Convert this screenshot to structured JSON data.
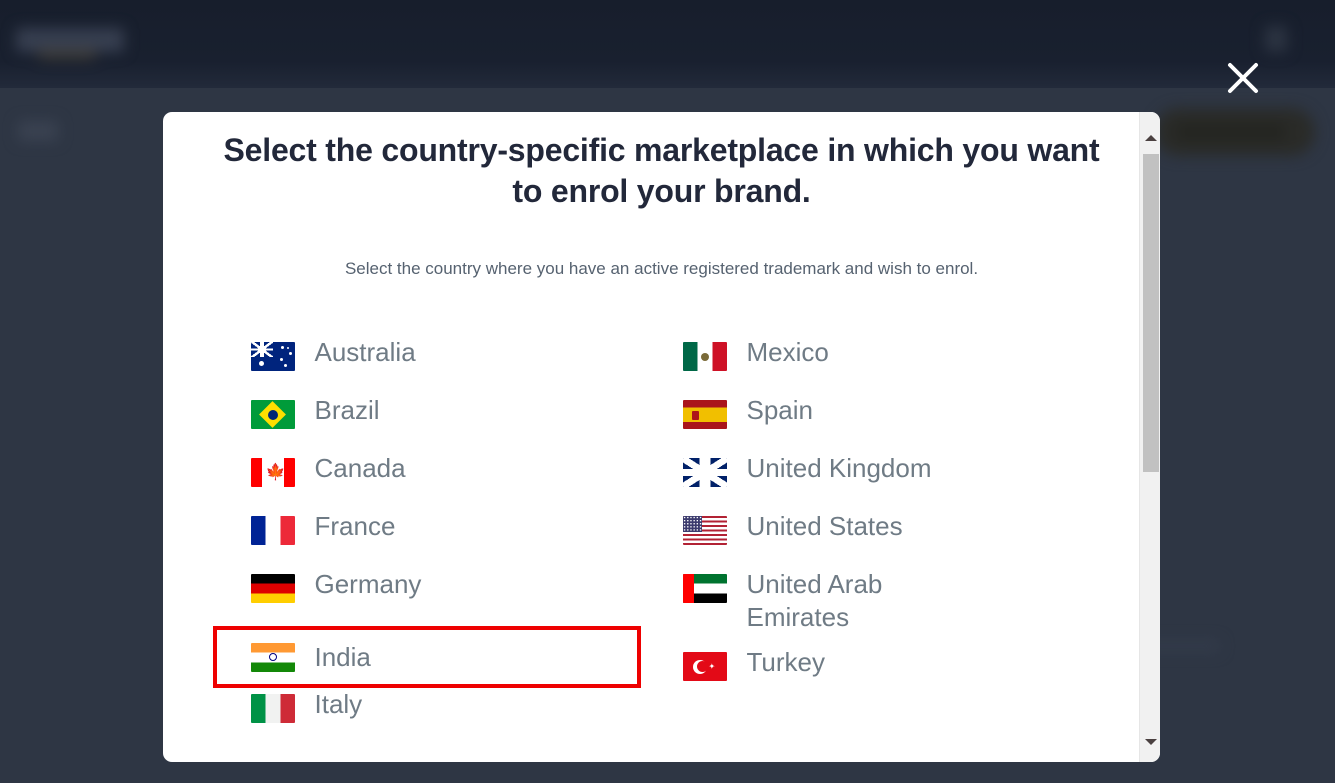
{
  "background": {
    "brand_logo": "amazon-logo",
    "nav_label_blurred": "blurred-nav-label",
    "action_button_blurred": "blurred-action-button"
  },
  "close": {
    "icon": "close-icon",
    "label": "Close"
  },
  "modal": {
    "title": "Select the country-specific marketplace in which you want to enrol your brand.",
    "subtitle": "Select the country where you have an active registered trademark and wish to enrol.",
    "highlight_color": "#ee0000",
    "highlighted_country": "India",
    "columns": {
      "left": [
        {
          "name": "Australia",
          "flag": "flag-australia"
        },
        {
          "name": "Brazil",
          "flag": "flag-brazil"
        },
        {
          "name": "Canada",
          "flag": "flag-canada"
        },
        {
          "name": "France",
          "flag": "flag-france"
        },
        {
          "name": "Germany",
          "flag": "flag-germany"
        },
        {
          "name": "India",
          "flag": "flag-india"
        },
        {
          "name": "Italy",
          "flag": "flag-italy"
        }
      ],
      "right": [
        {
          "name": "Mexico",
          "flag": "flag-mexico"
        },
        {
          "name": "Spain",
          "flag": "flag-spain"
        },
        {
          "name": "United Kingdom",
          "flag": "flag-united-kingdom"
        },
        {
          "name": "United States",
          "flag": "flag-united-states"
        },
        {
          "name": "United Arab\nEmirates",
          "flag": "flag-united-arab-emirates"
        },
        {
          "name": "Turkey",
          "flag": "flag-turkey"
        }
      ]
    }
  },
  "scrollbar": {
    "up_arrow": "scroll-up-arrow",
    "down_arrow": "scroll-down-arrow",
    "thumb": "scroll-thumb"
  }
}
